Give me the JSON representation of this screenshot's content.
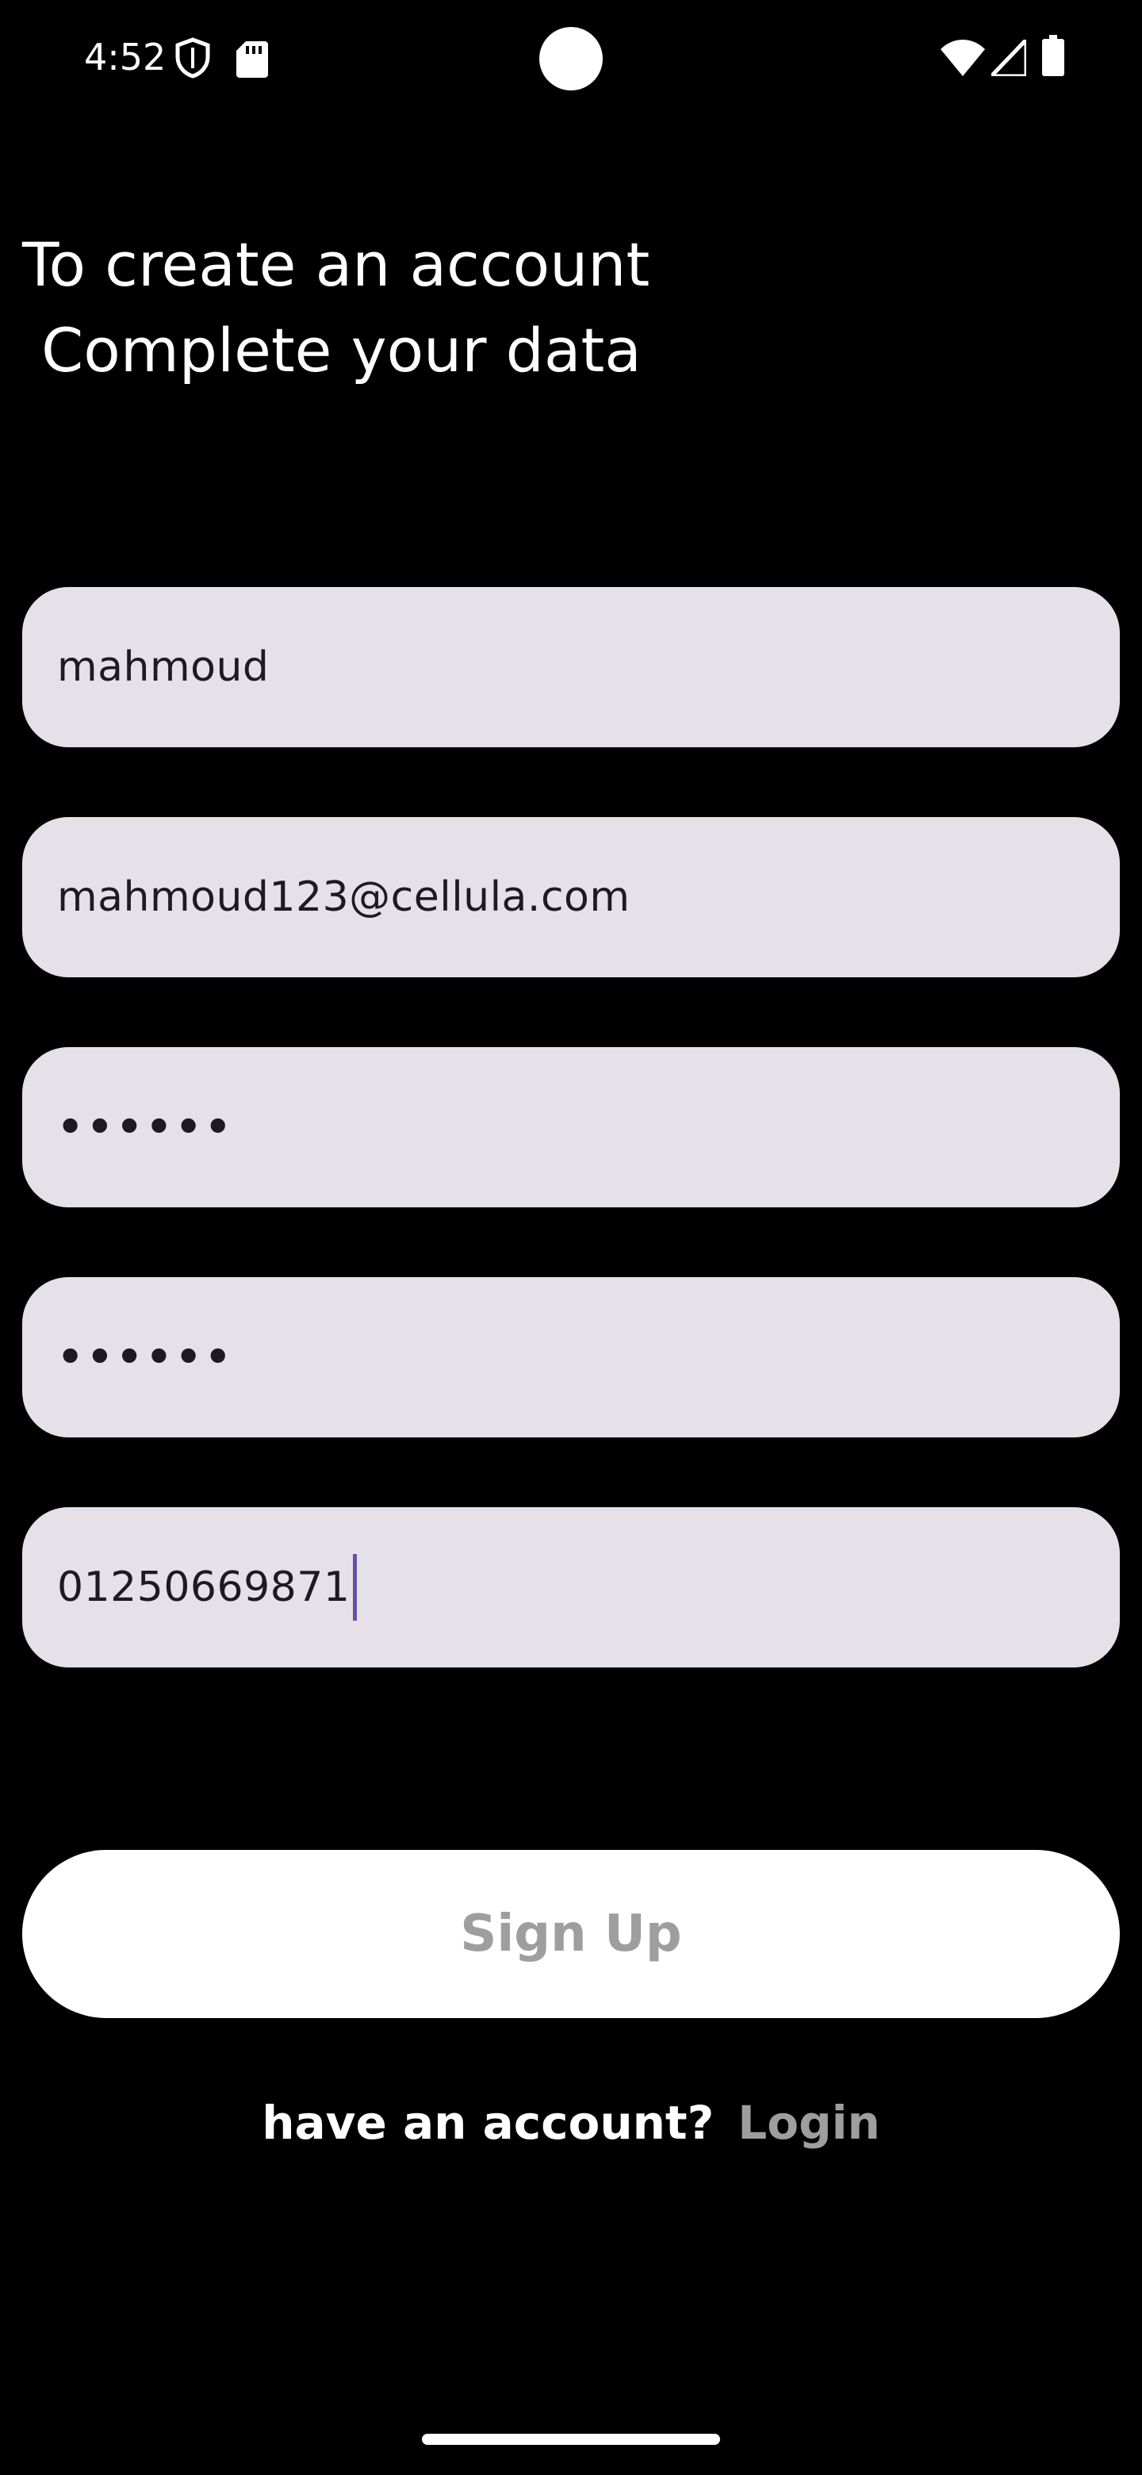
{
  "status_bar": {
    "time": "4:52",
    "icons": [
      "shield-icon",
      "sd-card-icon",
      "wifi-icon",
      "signal-icon",
      "battery-icon"
    ]
  },
  "heading": {
    "line1": "To create an account",
    "line2": " Complete your data"
  },
  "form": {
    "name_value": "mahmoud",
    "email_value": "mahmoud123@cellula.com",
    "password_value": "••••••",
    "confirm_password_value": "••••••",
    "phone_value": "01250669871"
  },
  "actions": {
    "signup_label": "Sign Up",
    "have_account_text": "have an account?",
    "login_label": "Login"
  },
  "colors": {
    "background": "#000000",
    "field_fill": "#e6e0e9",
    "caret": "#6750a4",
    "muted_text": "#9e9e9e"
  }
}
